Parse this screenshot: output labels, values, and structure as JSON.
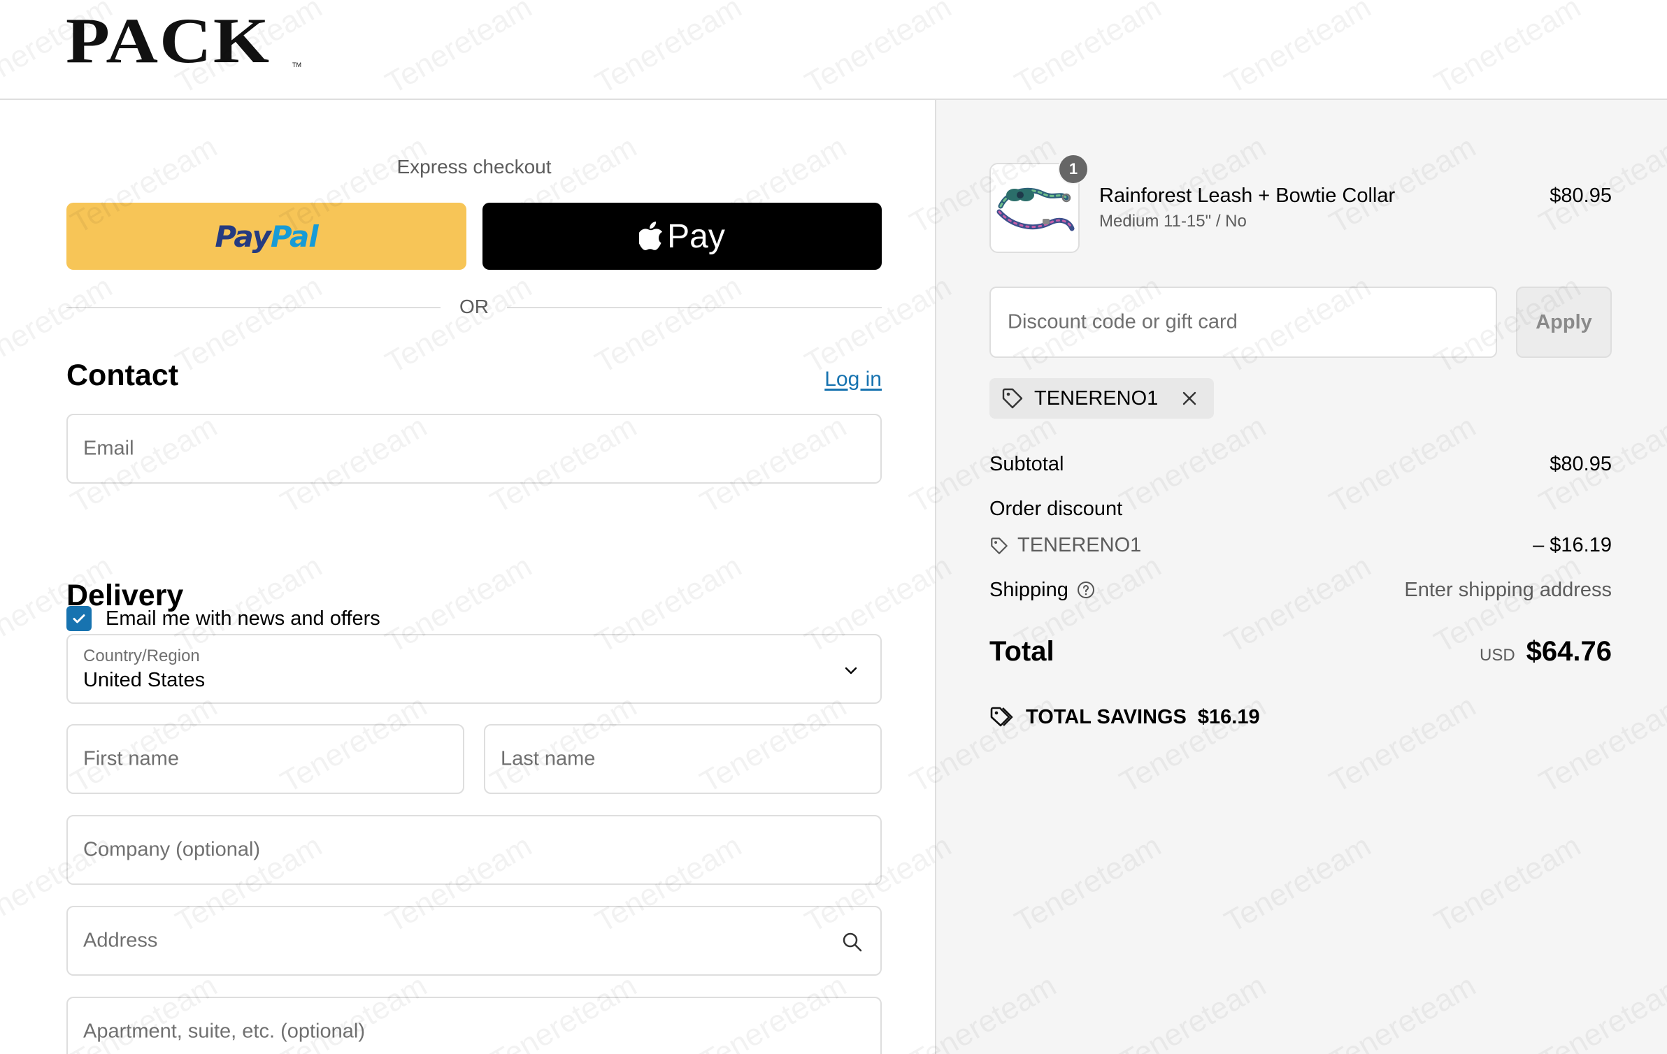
{
  "header": {
    "logo": "PACK",
    "logo_tm": "TM"
  },
  "express": {
    "title": "Express checkout",
    "paypal_part1": "Pay",
    "paypal_part2": "Pal",
    "applepay_label": "Pay",
    "divider": "OR"
  },
  "contact": {
    "title": "Contact",
    "login_label": "Log in",
    "email_placeholder": "Email",
    "newsletter_label": "Email me with news and offers",
    "newsletter_checked": true
  },
  "delivery": {
    "title": "Delivery",
    "country_label": "Country/Region",
    "country_value": "United States",
    "first_name_placeholder": "First name",
    "last_name_placeholder": "Last name",
    "company_placeholder": "Company (optional)",
    "address_placeholder": "Address",
    "apartment_placeholder": "Apartment, suite, etc. (optional)"
  },
  "summary": {
    "item": {
      "quantity": "1",
      "name": "Rainforest Leash + Bowtie Collar",
      "variant": "Medium 11-15\" / No",
      "price": "$80.95"
    },
    "discount_placeholder": "Discount code or gift card",
    "apply_label": "Apply",
    "applied_code": "TENERENO1",
    "subtotal_label": "Subtotal",
    "subtotal_value": "$80.95",
    "order_discount_label": "Order discount",
    "order_discount_code": "TENERENO1",
    "order_discount_value": "– $16.19",
    "shipping_label": "Shipping",
    "shipping_value": "Enter shipping address",
    "total_label": "Total",
    "total_currency": "USD",
    "total_value": "$64.76",
    "savings_label": "TOTAL SAVINGS",
    "savings_value": "$16.19"
  },
  "colors": {
    "paypal_bg": "#f7c557",
    "link": "#1773b0",
    "checkbox": "#1773b0",
    "summary_bg": "#f5f5f5"
  },
  "watermark": "Tenereteam"
}
